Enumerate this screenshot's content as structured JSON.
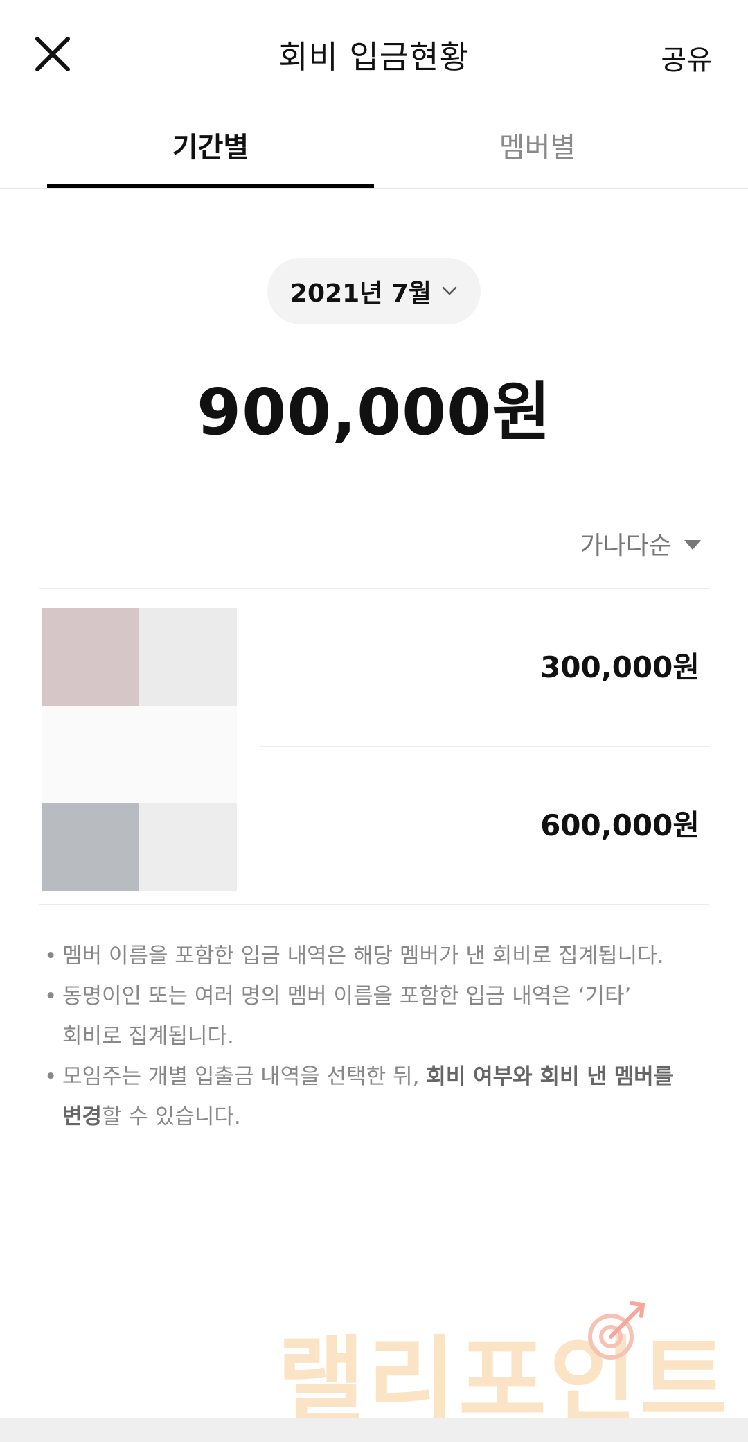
{
  "header": {
    "title": "회비 입금현황",
    "share_label": "공유",
    "close_icon": "close-icon"
  },
  "tabs": [
    {
      "label": "기간별",
      "active": true
    },
    {
      "label": "멤버별",
      "active": false
    }
  ],
  "period": {
    "label": "2021년 7월",
    "icon": "chevron-down-icon"
  },
  "total": "900,000원",
  "sort": {
    "label": "가나다순",
    "icon": "triangle-down-icon"
  },
  "members": [
    {
      "amount": "300,000원"
    },
    {
      "amount": "600,000원"
    }
  ],
  "notes": {
    "n1": "멤버 이름을 포함한 입금 내역은 해당 멤버가 낸 회비로 집계됩니다.",
    "n2_line1": "동명이인 또는 여러 명의 멤버 이름을 포함한 입금 내역은 ‘기타’",
    "n2_line2": "회비로 집계됩니다.",
    "n3_part1": "모임주는 개별 입출금 내역을 선택한 뒤, ",
    "n3_bold1": "회비 여부와 회비 낸 멤버를",
    "n3_bold2": "변경",
    "n3_part2": "할 수 있습니다.",
    "bullet": "•"
  },
  "watermark": "랠리포인트",
  "colors": {
    "accent": "#000000",
    "inactive_tab": "#8a8a8a",
    "pill_bg": "#f3f3f3",
    "avatar_a": "#d6c6c7",
    "avatar_b": "#ebebeb",
    "avatar_c": "#b8bbbf",
    "watermark": "#fbe0bc"
  }
}
